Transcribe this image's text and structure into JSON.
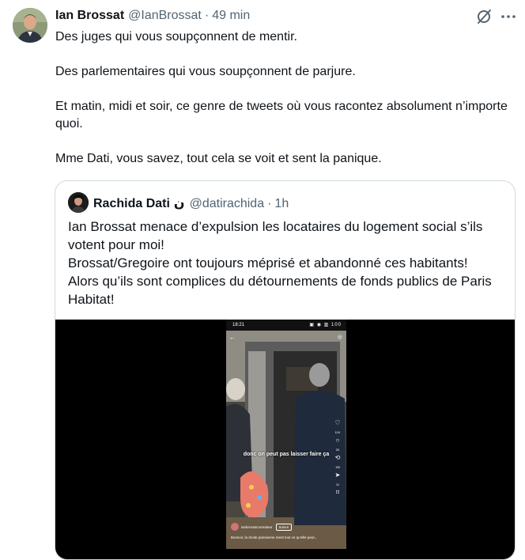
{
  "tweet": {
    "author_name": "Ian Brossat",
    "author_handle": "@IanBrossat",
    "separator": "·",
    "time": "49 min",
    "paragraphs": [
      "Des juges qui vous soupçonnent de mentir.",
      "Des parlementaires qui vous soupçonnent de parjure.",
      "Et matin, midi et soir, ce genre de tweets où vous racontez absolument n’importe quoi.",
      "Mme Dati, vous savez, tout cela se voit et sent la panique."
    ]
  },
  "quote": {
    "author_name": "Rachida Dati",
    "author_emoji": "ن",
    "author_handle": "@datirachida",
    "separator": "·",
    "time": "1h",
    "lines": [
      "Ian Brossat menace d’expulsion les locataires du logement social s’ils votent pour moi!",
      "Brossat/Gregoire ont toujours méprisé et abandonné ces habitants!",
      "Alors qu’ils sont complices du détournements de fonds publics de Paris Habitat!"
    ]
  },
  "video": {
    "status_time": "18:21",
    "status_icons": "▣ ◉ ▥ 100",
    "caption": "donc on peut pas laisser faire ça",
    "side_counts": [
      "11K",
      "20",
      "1M",
      "11"
    ],
    "reel_username": "ianbrossat.senateur",
    "follow_label": "Suivre",
    "description": "Bonsoir, la droite parisienne ment tout ce qu'elle peut..."
  },
  "icons": {
    "grok": "grok-icon",
    "more": "more-icon",
    "back": "back-arrow-icon"
  },
  "colors": {
    "text": "#0f1419",
    "secondary": "#536471",
    "border": "#cfd9de"
  }
}
